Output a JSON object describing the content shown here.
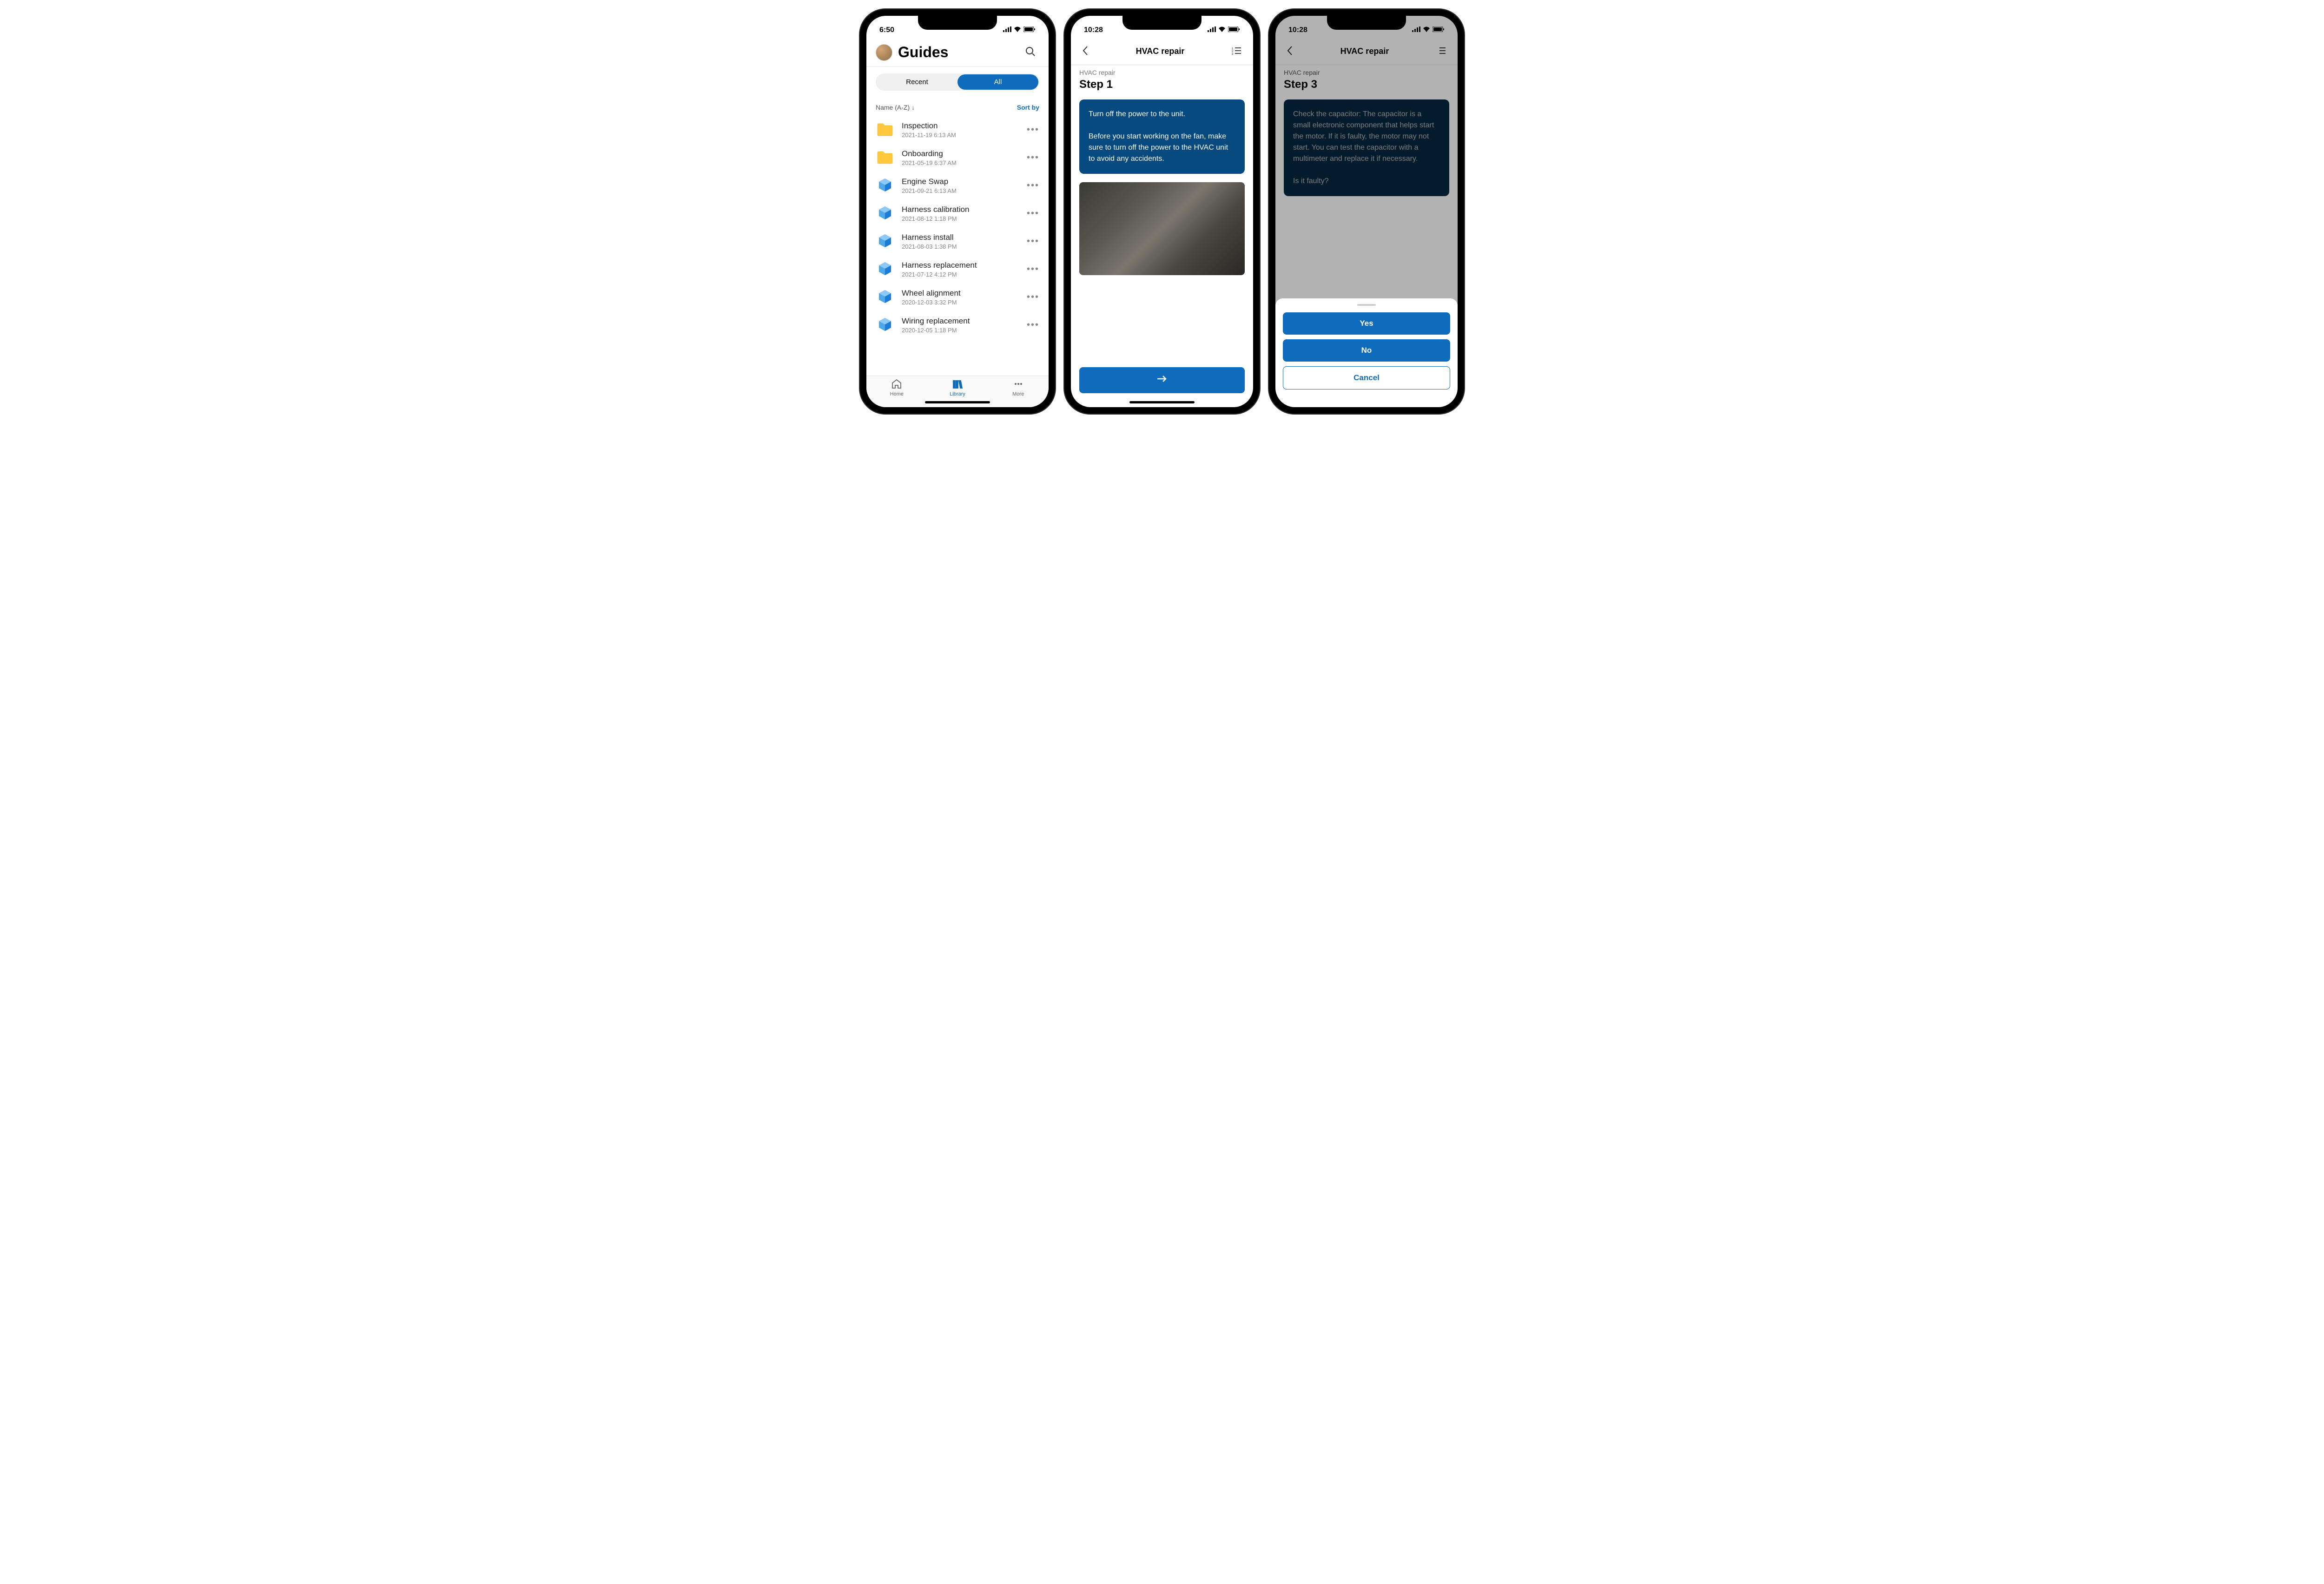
{
  "screen1": {
    "time": "6:50",
    "title": "Guides",
    "segments": {
      "recent": "Recent",
      "all": "All"
    },
    "sort_label": "Name (A-Z)",
    "sort_by": "Sort by",
    "items": [
      {
        "type": "folder",
        "title": "Inspection",
        "sub": "2021-11-19 6:13 AM"
      },
      {
        "type": "folder",
        "title": "Onboarding",
        "sub": "2021-05-19 6:37 AM"
      },
      {
        "type": "guide",
        "title": "Engine Swap",
        "sub": "2021-09-21 6:13 AM"
      },
      {
        "type": "guide",
        "title": "Harness calibration",
        "sub": "2021-08-12 1:18 PM"
      },
      {
        "type": "guide",
        "title": "Harness install",
        "sub": "2021-08-03 1:38 PM"
      },
      {
        "type": "guide",
        "title": "Harness replacement",
        "sub": "2021-07-12 4:12 PM"
      },
      {
        "type": "guide",
        "title": "Wheel alignment",
        "sub": "2020-12-03 3:32 PM"
      },
      {
        "type": "guide",
        "title": "Wiring replacement",
        "sub": "2020-12-05 1:18 PM"
      }
    ],
    "tabs": {
      "home": "Home",
      "library": "Library",
      "more": "More"
    }
  },
  "screen2": {
    "time": "10:28",
    "header_title": "HVAC repair",
    "guide_name": "HVAC repair",
    "step_title": "Step 1",
    "step_text": "Turn off the power to the unit.\n\nBefore you start working on the fan, make sure to turn off the power to the HVAC unit to avoid any accidents."
  },
  "screen3": {
    "time": "10:28",
    "header_title": "HVAC repair",
    "guide_name": "HVAC repair",
    "step_title": "Step 3",
    "step_text": "Check the capacitor: The capacitor is a small electronic component that helps start the motor. If it is faulty, the motor may not start. You can test the capacitor with a multimeter and replace it if necessary.\n\nIs it faulty?",
    "sheet": {
      "yes": "Yes",
      "no": "No",
      "cancel": "Cancel"
    }
  }
}
